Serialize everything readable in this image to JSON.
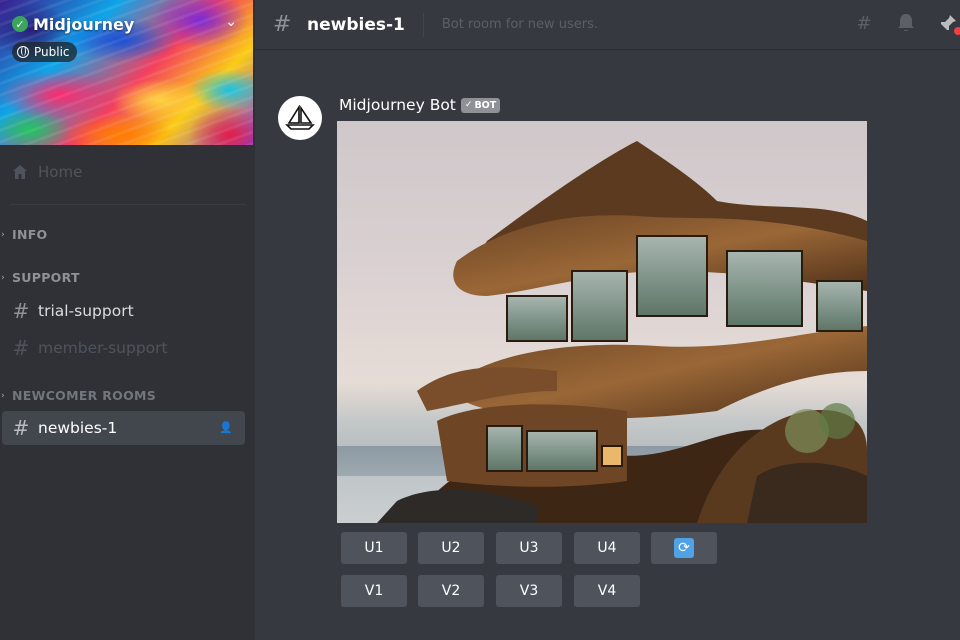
{
  "server": {
    "name": "Midjourney",
    "visibility": "Public"
  },
  "sidebar": {
    "home_label": "Home",
    "categories": [
      {
        "label": "INFO"
      },
      {
        "label": "SUPPORT"
      },
      {
        "label": "NEWCOMER ROOMS"
      }
    ],
    "channels": [
      {
        "label": "trial-support",
        "state": "normal"
      },
      {
        "label": "member-support",
        "state": "muted"
      },
      {
        "label": "newbies-1",
        "state": "active"
      }
    ]
  },
  "channel_header": {
    "title": "newbies-1",
    "topic": "Bot room for new users."
  },
  "message": {
    "author": "Midjourney Bot",
    "badge": "BOT"
  },
  "buttons": {
    "upscale": [
      "U1",
      "U2",
      "U3",
      "U4"
    ],
    "variation": [
      "V1",
      "V2",
      "V3",
      "V4"
    ]
  },
  "colors": {
    "sidebar_bg": "#2f3136",
    "main_bg": "#36393f",
    "active_channel": "#42464d",
    "button_bg": "#4f545c",
    "refresh_blue": "#4fa2e6",
    "verified_green": "#3ba55c"
  },
  "icons": [
    "verified-check-icon",
    "chevron-down-icon",
    "globe-icon",
    "home-icon",
    "hash-icon",
    "threads-icon",
    "bell-icon",
    "pin-icon",
    "add-user-icon",
    "refresh-icon",
    "sailboat-icon"
  ]
}
